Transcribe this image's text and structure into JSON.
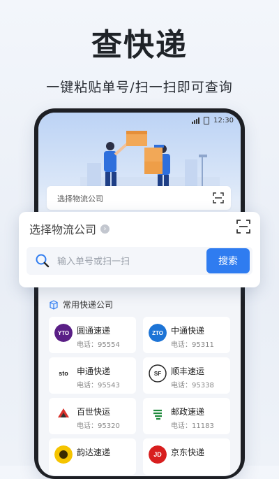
{
  "hero": {
    "title": "查快递",
    "subtitle": "一键粘贴单号/扫一扫即可查询"
  },
  "status_bar": {
    "time": "12:30"
  },
  "inner_search": {
    "label": "选择物流公司"
  },
  "search_card": {
    "company_label": "选择物流公司",
    "input_placeholder": "输入单号或扫一扫",
    "button_label": "搜索"
  },
  "section": {
    "title": "常用快递公司"
  },
  "companies": [
    {
      "name": "圆通速递",
      "phone": "电话：95554",
      "logo_text": "YTO"
    },
    {
      "name": "中通快递",
      "phone": "电话：95311",
      "logo_text": "ZTO"
    },
    {
      "name": "申通快递",
      "phone": "电话：95543",
      "logo_text": "sto"
    },
    {
      "name": "顺丰速运",
      "phone": "电话：95338",
      "logo_text": "SF"
    },
    {
      "name": "百世快运",
      "phone": "电话：95320",
      "logo_text": ""
    },
    {
      "name": "邮政速递",
      "phone": "电话：11183",
      "logo_text": ""
    },
    {
      "name": "韵达速递",
      "phone": "",
      "logo_text": ""
    },
    {
      "name": "京东快递",
      "phone": "",
      "logo_text": "JD"
    }
  ],
  "colors": {
    "accent": "#2f7cf0",
    "yto": "#5a1f86",
    "zto": "#1d74d6",
    "sf": "#222222",
    "best": "#d9322c",
    "ems": "#1f8a3b",
    "yunda": "#f5c400",
    "jd": "#d81e1e"
  }
}
